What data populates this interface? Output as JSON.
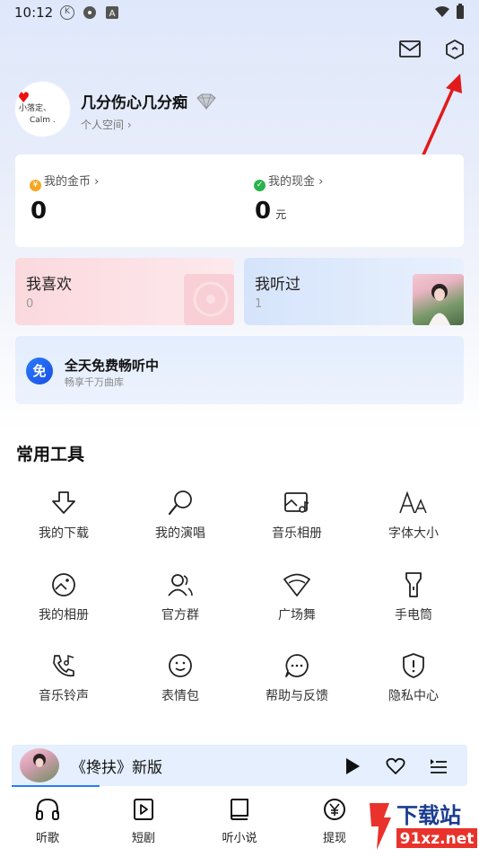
{
  "status_bar": {
    "time": "10:12"
  },
  "profile": {
    "username": "几分伤心几分痴",
    "space_link": "个人空间 ›",
    "avatar_text_top": "小落定、",
    "avatar_text_bottom": "Calm ."
  },
  "wallet": {
    "coins_label": "我的金币 ›",
    "coins_value": "0",
    "cash_label": "我的现金 ›",
    "cash_value": "0",
    "cash_unit": "元"
  },
  "playlists": {
    "liked_title": "我喜欢",
    "liked_count": "0",
    "heard_title": "我听过",
    "heard_count": "1"
  },
  "free_banner": {
    "badge": "免",
    "title": "全天免费畅听中",
    "subtitle": "畅享千万曲库"
  },
  "tools": {
    "section_title": "常用工具",
    "items": [
      {
        "label": "我的下载",
        "icon": "download-icon"
      },
      {
        "label": "我的演唱",
        "icon": "microphone-icon"
      },
      {
        "label": "音乐相册",
        "icon": "music-album-icon"
      },
      {
        "label": "字体大小",
        "icon": "font-size-icon"
      },
      {
        "label": "我的相册",
        "icon": "photo-album-icon"
      },
      {
        "label": "官方群",
        "icon": "group-icon"
      },
      {
        "label": "广场舞",
        "icon": "square-dance-icon"
      },
      {
        "label": "手电筒",
        "icon": "flashlight-icon"
      },
      {
        "label": "音乐铃声",
        "icon": "ringtone-icon"
      },
      {
        "label": "表情包",
        "icon": "emoji-icon"
      },
      {
        "label": "帮助与反馈",
        "icon": "help-feedback-icon"
      },
      {
        "label": "隐私中心",
        "icon": "privacy-icon"
      }
    ]
  },
  "mini_player": {
    "song_title": "《搀扶》新版"
  },
  "bottom_nav": {
    "items": [
      {
        "label": "听歌",
        "icon": "headphones-icon"
      },
      {
        "label": "短剧",
        "icon": "short-drama-icon"
      },
      {
        "label": "听小说",
        "icon": "book-icon"
      },
      {
        "label": "提现",
        "icon": "withdraw-icon"
      }
    ]
  },
  "watermark": {
    "text_cn": "下载站",
    "text_url": "91xz.net"
  },
  "colors": {
    "accent": "#2a7bff",
    "arrow": "#e01b1b",
    "coin": "#f5a623",
    "cash": "#2bb34b"
  }
}
